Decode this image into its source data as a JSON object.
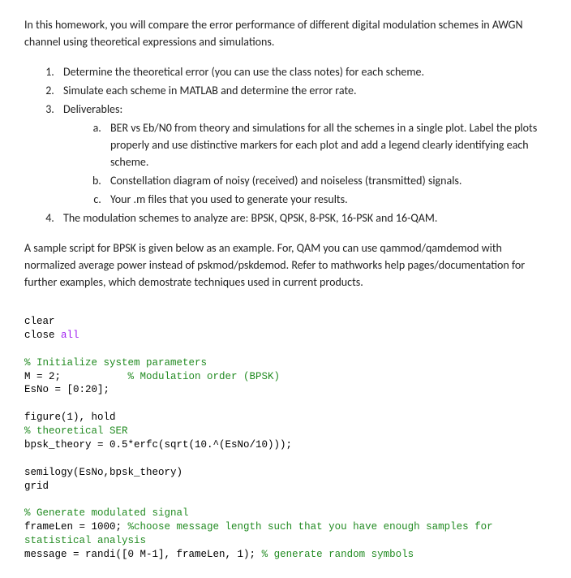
{
  "intro": "In this homework, you will compare the error performance of different digital modulation schemes in AWGN channel using theoretical expressions and simulations.",
  "list": {
    "item1": "Determine the theoretical error (you can use the class notes) for each scheme.",
    "item2": "Simulate each scheme in MATLAB and determine the error rate.",
    "item3": "Deliverables:",
    "item3a": "BER vs Eb/N0 from theory and simulations for all the schemes in a single plot. Label the plots properly and use distinctive markers for each plot and add a legend clearly identifying each scheme.",
    "item3b": "Constellation diagram of noisy (received) and noiseless (transmitted) signals.",
    "item3c": "Your .m files that you used to generate your results.",
    "item4": "The modulation schemes to analyze are: BPSK, QPSK, 8-PSK, 16-PSK and 16-QAM."
  },
  "para2": "A sample script for BPSK is given below as an example. For, QAM you can use qammod/qamdemod with normalized average power instead of pskmod/pskdemod. Refer to mathworks help pages/documentation for further examples, which demostrate techniques used in current products.",
  "code": {
    "l1": "clear",
    "l2a": "close ",
    "l2b": "all",
    "l3": "% Initialize system parameters",
    "l4a": "M = 2;           ",
    "l4b": "% Modulation order (BPSK)",
    "l5": "EsNo = [0:20];",
    "l6": "figure(1), hold",
    "l7": "% theoretical SER",
    "l8": "bpsk_theory = 0.5*erfc(sqrt(10.^(EsNo/10)));",
    "l9": "semilogy(EsNo,bpsk_theory)",
    "l10": "grid",
    "l11": "% Generate modulated signal",
    "l12a": "frameLen = 1000; ",
    "l12b": "%choose message length such that you have enough samples for ",
    "l12c": "statistical analysis",
    "l13a": "message = randi([0 M-1], frameLen, 1); ",
    "l13b": "% generate random symbols"
  }
}
